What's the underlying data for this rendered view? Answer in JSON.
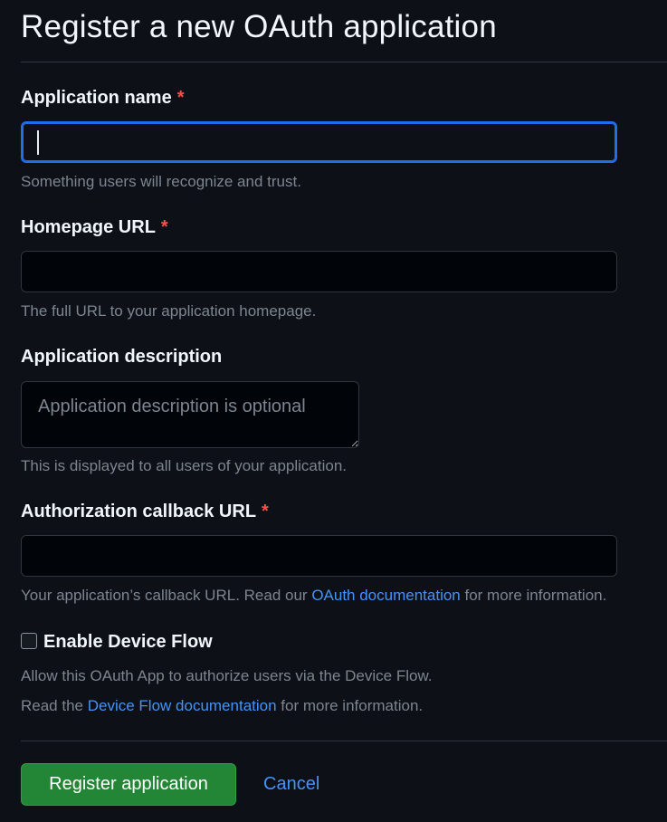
{
  "page": {
    "title": "Register a new OAuth application"
  },
  "fields": {
    "app_name": {
      "label": "Application name",
      "required_mark": "*",
      "value": "",
      "help": "Something users will recognize and trust."
    },
    "homepage_url": {
      "label": "Homepage URL",
      "required_mark": "*",
      "value": "",
      "help": "The full URL to your application homepage."
    },
    "description": {
      "label": "Application description",
      "placeholder": "Application description is optional",
      "value": "",
      "help": "This is displayed to all users of your application."
    },
    "callback_url": {
      "label": "Authorization callback URL",
      "required_mark": "*",
      "value": "",
      "help_prefix": "Your application’s callback URL. Read our ",
      "help_link": "OAuth documentation",
      "help_suffix": " for more information."
    }
  },
  "device_flow": {
    "label": "Enable Device Flow",
    "checked": false,
    "help_line1": "Allow this OAuth App to authorize users via the Device Flow.",
    "help_line2_prefix": "Read the ",
    "help_line2_link": "Device Flow documentation",
    "help_line2_suffix": " for more information."
  },
  "actions": {
    "submit_label": "Register application",
    "cancel_label": "Cancel"
  },
  "colors": {
    "background": "#0d1117",
    "focus_border": "#1f6feb",
    "primary_button": "#238636",
    "link": "#4493f8",
    "required": "#f85149",
    "muted_text": "#7d8590"
  }
}
